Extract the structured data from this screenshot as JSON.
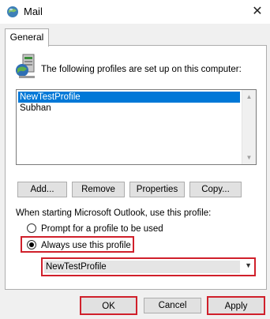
{
  "window": {
    "title": "Mail",
    "icon": "mail-setup-icon",
    "close_glyph": "✕"
  },
  "tabs": [
    {
      "label": "General",
      "selected": true
    }
  ],
  "profiles_section": {
    "heading": "The following profiles are set up on this computer:",
    "icon": "profiles-icon",
    "profiles": [
      {
        "name": "NewTestProfile",
        "selected": true
      },
      {
        "name": "Subhan",
        "selected": false
      }
    ]
  },
  "profile_buttons": {
    "add": "Add...",
    "remove": "Remove",
    "properties": "Properties",
    "copy": "Copy..."
  },
  "startup": {
    "label": "When starting Microsoft Outlook, use this profile:",
    "options": [
      {
        "label": "Prompt for a profile to be used",
        "checked": false
      },
      {
        "label": "Always use this profile",
        "checked": true
      }
    ],
    "selected_profile": "NewTestProfile"
  },
  "footer_buttons": {
    "ok": "OK",
    "cancel": "Cancel",
    "apply": "Apply"
  },
  "colors": {
    "highlight_border": "#d0202b",
    "selection": "#0078d7",
    "dialog_background": "#f0f0f0"
  }
}
